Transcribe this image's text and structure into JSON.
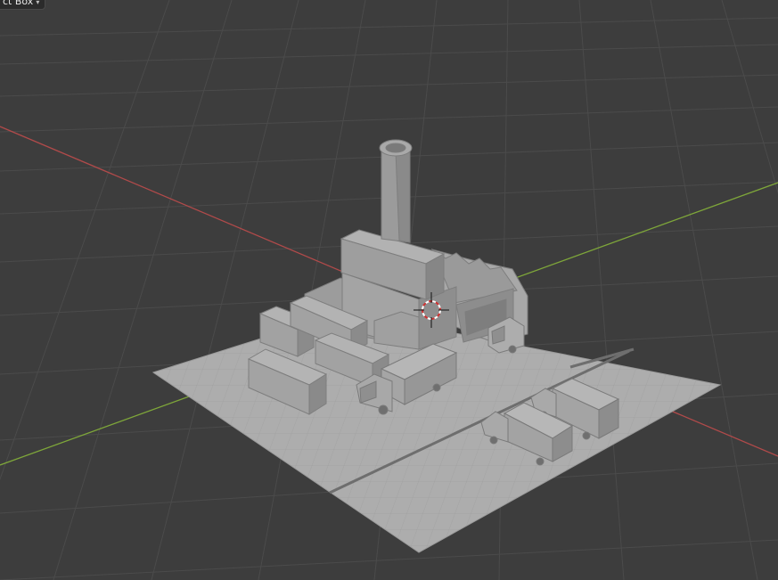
{
  "toolbar": {
    "select_tool_label": "ct Box",
    "dropdown_glyph": "▾"
  },
  "viewport": {
    "background": "#3d3d3d",
    "grid_color": "#4a4a4a",
    "x_axis_color": "#b04a4a",
    "y_axis_color": "#7ea63a",
    "mesh_color": "#a6a6a6",
    "cursor": "3d-cursor-icon"
  }
}
